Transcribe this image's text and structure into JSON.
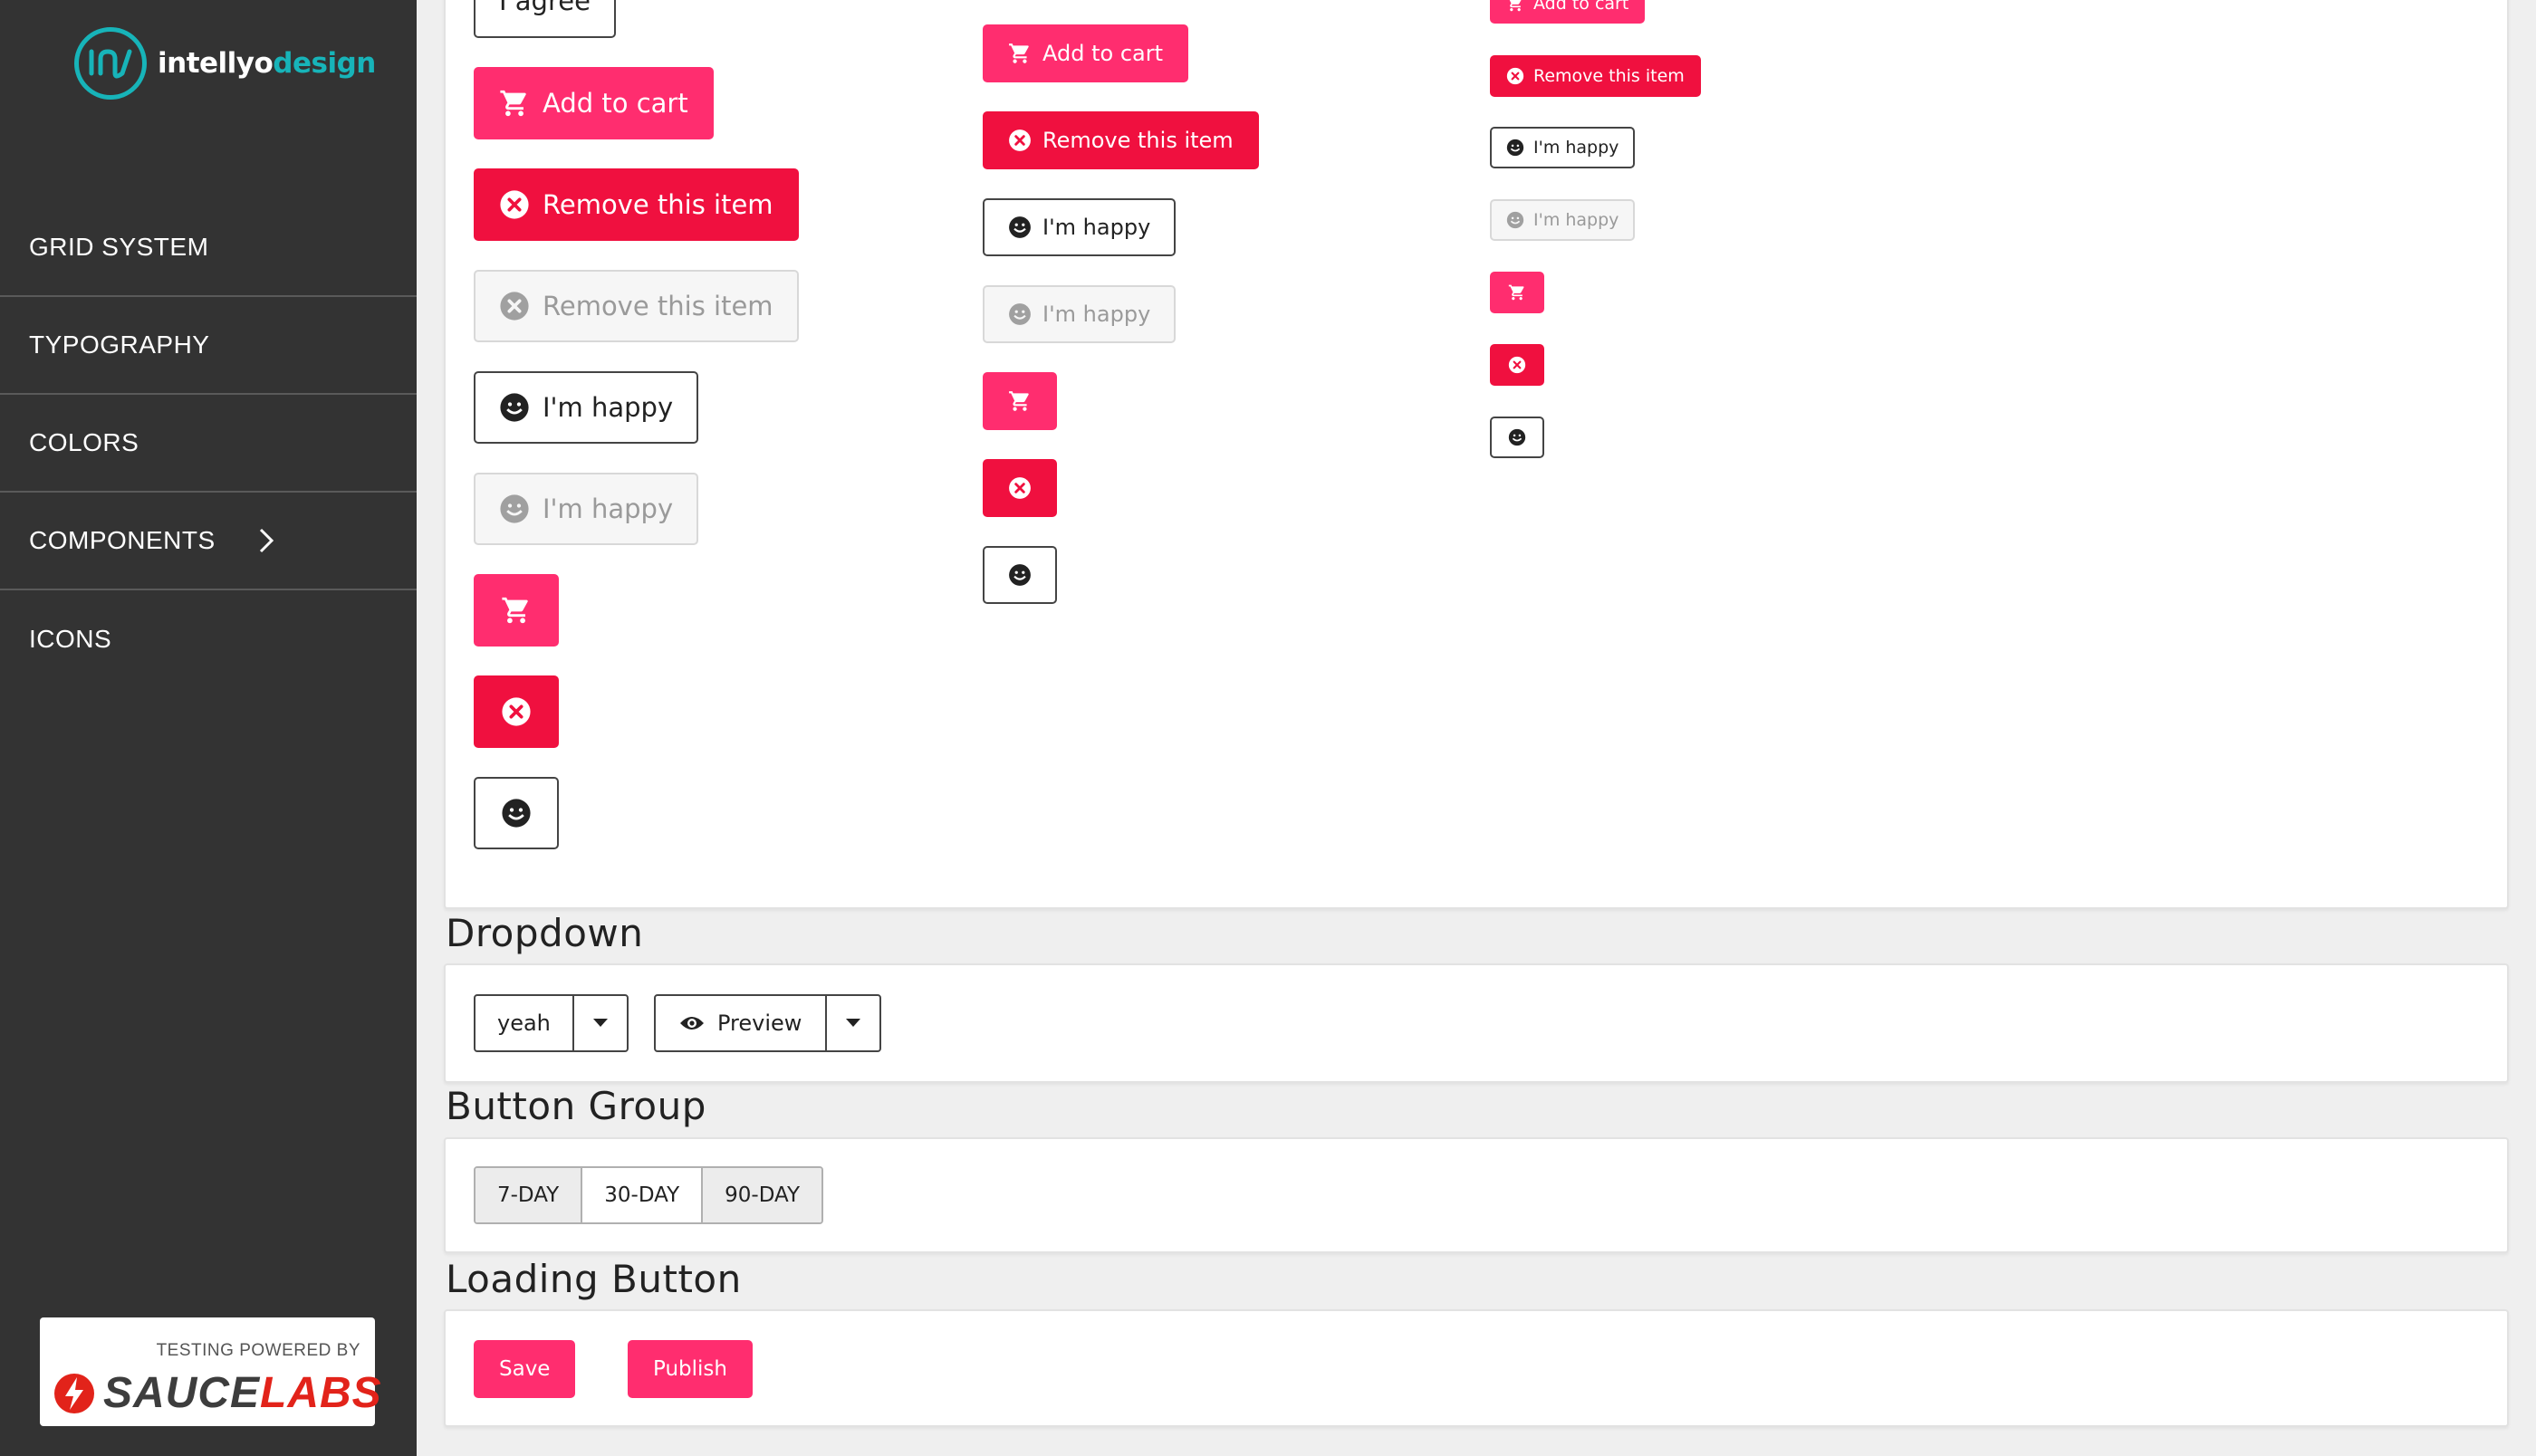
{
  "brand": {
    "logo_part1": "intellyo",
    "logo_part2": "design",
    "accent": "#17b4b9"
  },
  "sidebar": {
    "items": [
      {
        "label": "GRID SYSTEM"
      },
      {
        "label": "TYPOGRAPHY"
      },
      {
        "label": "COLORS"
      },
      {
        "label": "COMPONENTS",
        "icon": "chevron-right-icon"
      },
      {
        "label": "ICONS"
      }
    ],
    "sponsor": {
      "tagline": "TESTING POWERED BY",
      "name_part1": "SAUCE",
      "name_part2": "LABS"
    }
  },
  "buttons": {
    "agree_label": "I agree",
    "add_to_cart_label": "Add to cart",
    "remove_item_label": "Remove this item",
    "happy_label": "I'm happy",
    "icons": [
      "cart-icon",
      "close-circle-icon",
      "smiley-icon"
    ],
    "colors": {
      "primary": "#ff2d6f",
      "danger": "#f0103f"
    }
  },
  "dropdown": {
    "title": "Dropdown",
    "first_value": "yeah",
    "preview_label": "Preview"
  },
  "button_group": {
    "title": "Button Group",
    "options": [
      "7-DAY",
      "30-DAY",
      "90-DAY"
    ],
    "selected": "30-DAY"
  },
  "loading_button": {
    "title": "Loading Button",
    "save_label": "Save",
    "publish_label": "Publish"
  }
}
